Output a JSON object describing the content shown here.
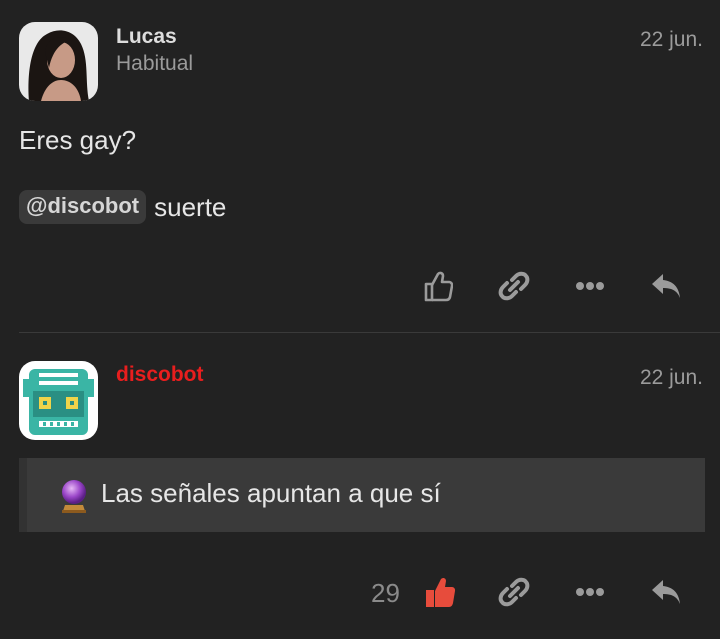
{
  "posts": [
    {
      "username": "Lucas",
      "user_title": "Habitual",
      "date": "22 jun.",
      "body": {
        "text": "Eres gay?",
        "mention": "@discobot",
        "after_mention": "suerte"
      },
      "actions": [
        "like-outline-icon",
        "link-icon",
        "more-icon",
        "reply-icon"
      ]
    },
    {
      "username": "discobot",
      "date": "22 jun.",
      "quote": "Las señales apuntan a que sí",
      "likes": "29",
      "actions": [
        "like-filled-icon",
        "link-icon",
        "more-icon",
        "reply-icon"
      ]
    }
  ],
  "colors": {
    "background": "#222222",
    "bot_username": "#e81e1e",
    "liked": "#e74c3c",
    "muted": "#9b9b9b"
  }
}
